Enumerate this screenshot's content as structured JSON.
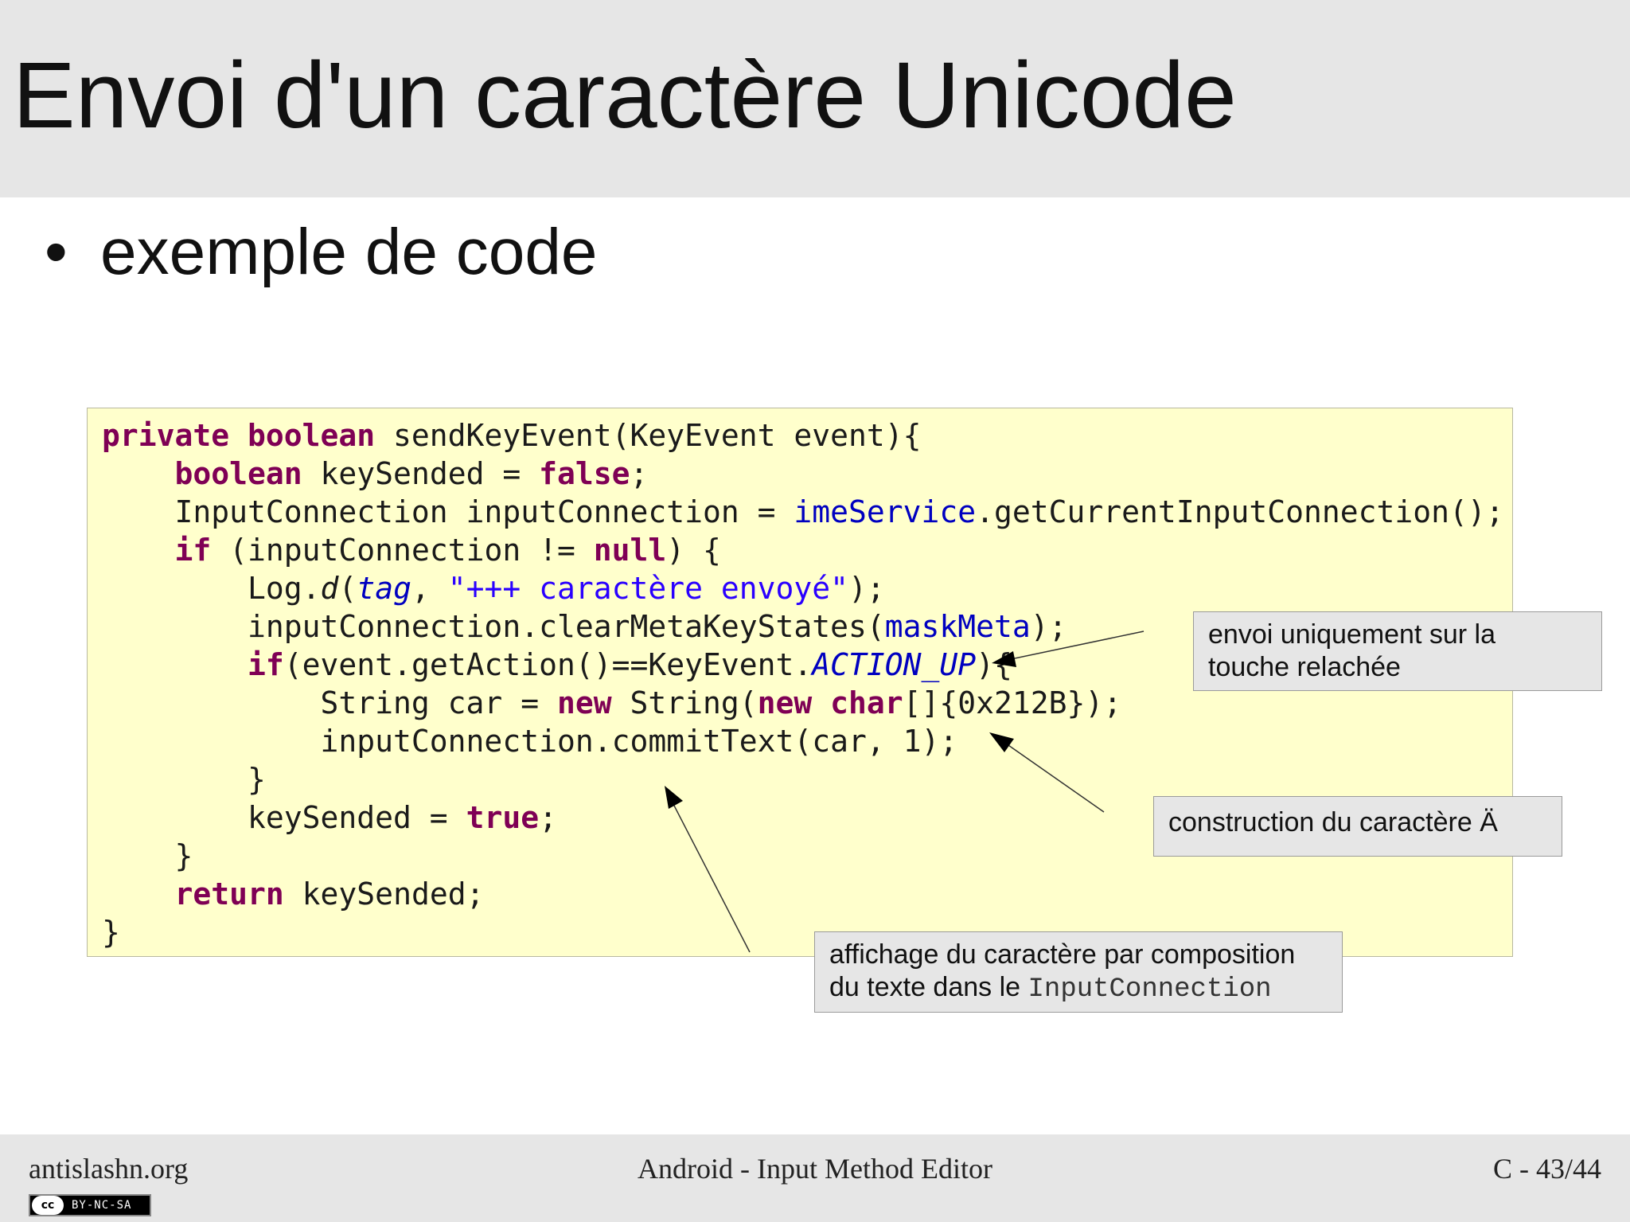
{
  "slide": {
    "title": "Envoi d'un caractère Unicode",
    "bullet_symbol": "•",
    "bullet_text": "exemple de code"
  },
  "code": {
    "lines": [
      [
        {
          "t": "private boolean",
          "c": "kw"
        },
        {
          "t": " sendKeyEvent(KeyEvent event){"
        }
      ],
      [
        {
          "t": "    "
        },
        {
          "t": "boolean",
          "c": "kw"
        },
        {
          "t": " keySended = "
        },
        {
          "t": "false",
          "c": "kw"
        },
        {
          "t": ";"
        }
      ],
      [
        {
          "t": "    InputConnection inputConnection = "
        },
        {
          "t": "imeService",
          "c": "fld"
        },
        {
          "t": ".getCurrentInputConnection();"
        }
      ],
      [
        {
          "t": "    "
        },
        {
          "t": "if",
          "c": "kw"
        },
        {
          "t": " (inputConnection != "
        },
        {
          "t": "null",
          "c": "kw"
        },
        {
          "t": ") {"
        }
      ],
      [
        {
          "t": "        Log."
        },
        {
          "t": "d",
          "c": "it"
        },
        {
          "t": "("
        },
        {
          "t": "tag",
          "c": "fld it"
        },
        {
          "t": ", "
        },
        {
          "t": "\"+++ caractère envoyé\"",
          "c": "str"
        },
        {
          "t": ");"
        }
      ],
      [
        {
          "t": "        inputConnection.clearMetaKeyStates("
        },
        {
          "t": "maskMeta",
          "c": "fld"
        },
        {
          "t": ");"
        }
      ],
      [
        {
          "t": "        "
        },
        {
          "t": "if",
          "c": "kw"
        },
        {
          "t": "(event.getAction()==KeyEvent."
        },
        {
          "t": "ACTION_UP",
          "c": "fld it"
        },
        {
          "t": "){"
        }
      ],
      [
        {
          "t": "            String car = "
        },
        {
          "t": "new",
          "c": "kw"
        },
        {
          "t": " String("
        },
        {
          "t": "new char",
          "c": "kw"
        },
        {
          "t": "[]{0x212B});"
        }
      ],
      [
        {
          "t": "            inputConnection.commitText(car, 1);"
        }
      ],
      [
        {
          "t": "        }"
        }
      ],
      [
        {
          "t": "        keySended = "
        },
        {
          "t": "true",
          "c": "kw"
        },
        {
          "t": ";"
        }
      ],
      [
        {
          "t": "    }"
        }
      ],
      [
        {
          "t": "    "
        },
        {
          "t": "return",
          "c": "kw"
        },
        {
          "t": " keySended;"
        }
      ],
      [
        {
          "t": "}"
        }
      ]
    ]
  },
  "annotations": {
    "note1": {
      "line1": "envoi uniquement sur la",
      "line2": "touche relachée"
    },
    "note2": {
      "text": "construction du caractère Ä"
    },
    "note3": {
      "line1": "affichage du caractère par composition",
      "line2_prefix": "du texte dans le ",
      "line2_code": "InputConnection"
    }
  },
  "footer": {
    "left": "antislashn.org",
    "center": "Android - Input Method Editor",
    "right": "C - 43/44",
    "license_circle": "cc",
    "license_text": "BY-NC-SA"
  }
}
